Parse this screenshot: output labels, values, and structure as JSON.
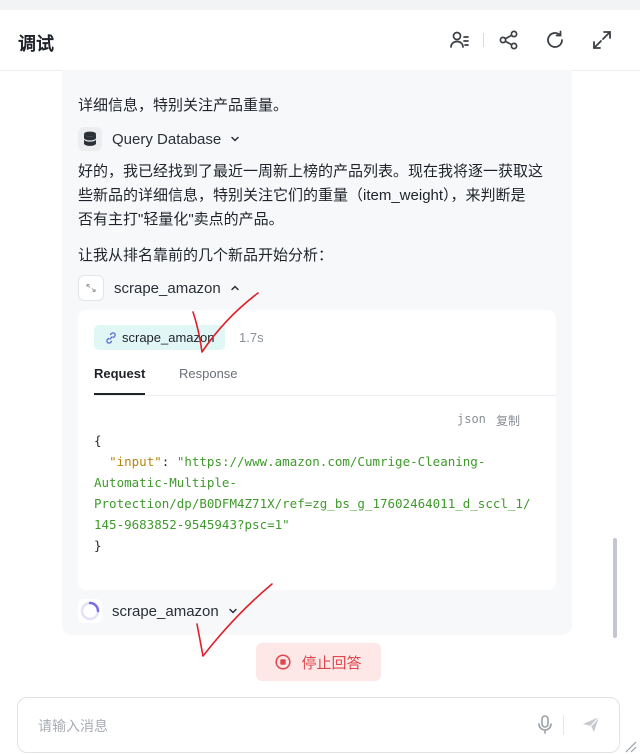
{
  "header": {
    "title": "调试"
  },
  "messages": {
    "line_top": "详细信息，特别关注产品重量。",
    "tool1": {
      "name": "Query Database"
    },
    "paragraph1_lines": [
      "好的，我已经找到了最近一周新上榜的产品列表。现在我将逐一获取这",
      "些新品的详细信息，特别关注它们的重量（item_weight），来判断是",
      "否有主打\"轻量化\"卖点的产品。"
    ],
    "paragraph2": "让我从排名靠前的几个新品开始分析：",
    "tool2": {
      "name": "scrape_amazon",
      "chip_label": "scrape_amazon",
      "duration": "1.7s",
      "tabs": [
        "Request",
        "Response"
      ],
      "code_lang": "json",
      "copy_label": "复制",
      "code": {
        "open": "{",
        "key": "\"input\"",
        "colon": ": ",
        "value_lines": [
          "\"https://www.amazon.com/Cumrige-Cleaning-",
          "Automatic-Multiple-",
          "Protection/dp/B0DFM4Z71X/ref=zg_bs_g_17602464011_d_sccl_1/",
          "145-9683852-9545943?psc=1\""
        ],
        "close": "}"
      }
    },
    "tool3": {
      "name": "scrape_amazon"
    }
  },
  "stop_button": {
    "label": "停止回答"
  },
  "composer": {
    "placeholder": "请输入消息"
  },
  "colors": {
    "accent_stop": "#e0474c",
    "chip_bg": "#e0f7f6",
    "annotation": "#e0202a"
  }
}
